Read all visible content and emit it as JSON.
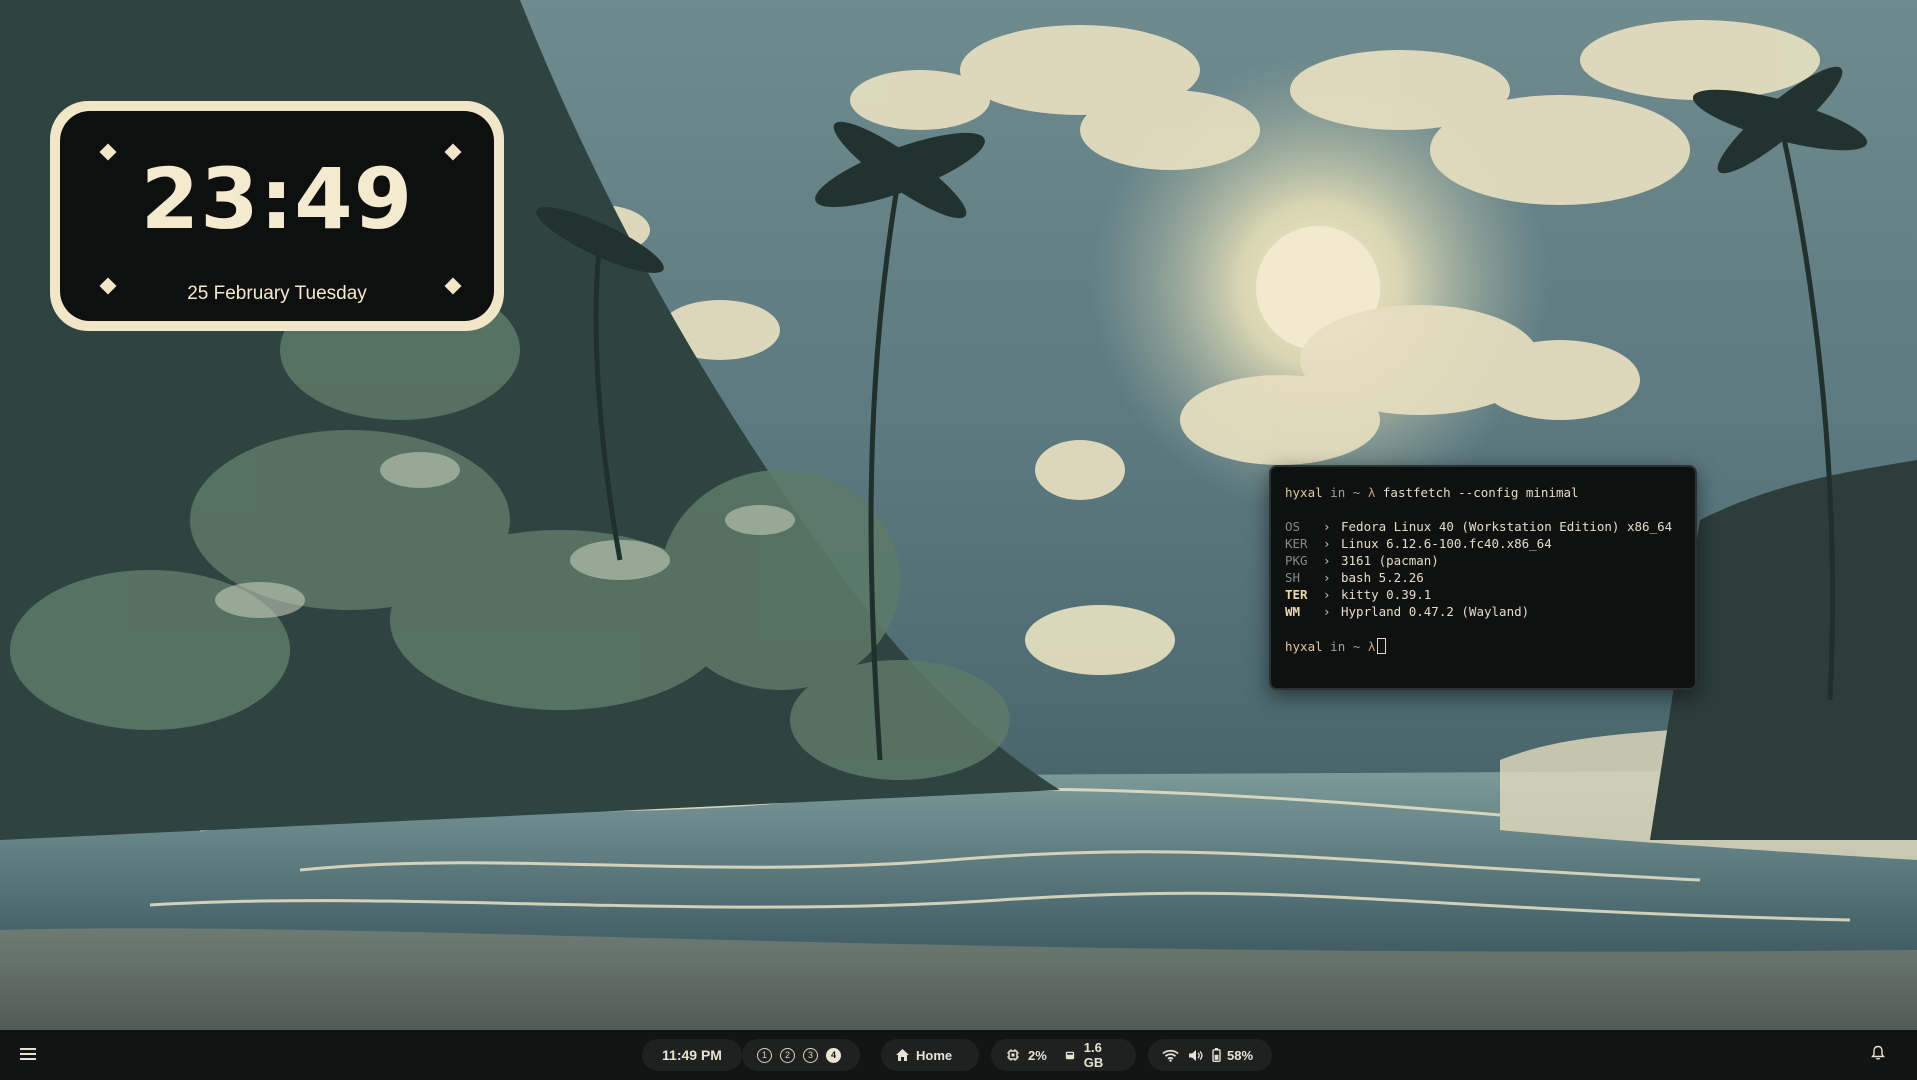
{
  "clock_widget": {
    "time": "23:49",
    "date": "25 February Tuesday"
  },
  "terminal": {
    "prompt_user": "hyxal",
    "prompt_in": "in",
    "prompt_dir": "~",
    "prompt_symbol": "λ",
    "command": "fastfetch --config minimal",
    "arrow": "›",
    "info": [
      {
        "key": "OS",
        "value": "Fedora Linux 40 (Workstation Edition) x86_64"
      },
      {
        "key": "KER",
        "value": "Linux 6.12.6-100.fc40.x86_64"
      },
      {
        "key": "PKG",
        "value": "3161 (pacman)"
      },
      {
        "key": "SH",
        "value": "bash 5.2.26"
      },
      {
        "key": "TER",
        "value": "kitty 0.39.1"
      },
      {
        "key": "WM",
        "value": "Hyprland 0.47.2 (Wayland)"
      }
    ]
  },
  "bar": {
    "time": "11:49 PM",
    "workspaces": [
      {
        "label": "1",
        "active": false
      },
      {
        "label": "2",
        "active": false
      },
      {
        "label": "3",
        "active": false
      },
      {
        "label": "4",
        "active": true
      }
    ],
    "home_label": "Home",
    "cpu": "2%",
    "memory": "1.6 GB",
    "battery": "58%"
  },
  "icons": [
    "menu-icon",
    "home-icon",
    "cpu-icon",
    "memory-icon",
    "wifi-icon",
    "volume-icon",
    "battery-icon",
    "bell-icon"
  ],
  "colors": {
    "accent_cream": "#f1e6c8",
    "bar_bg": "#121313",
    "terminal_bg": "#0f1010"
  }
}
